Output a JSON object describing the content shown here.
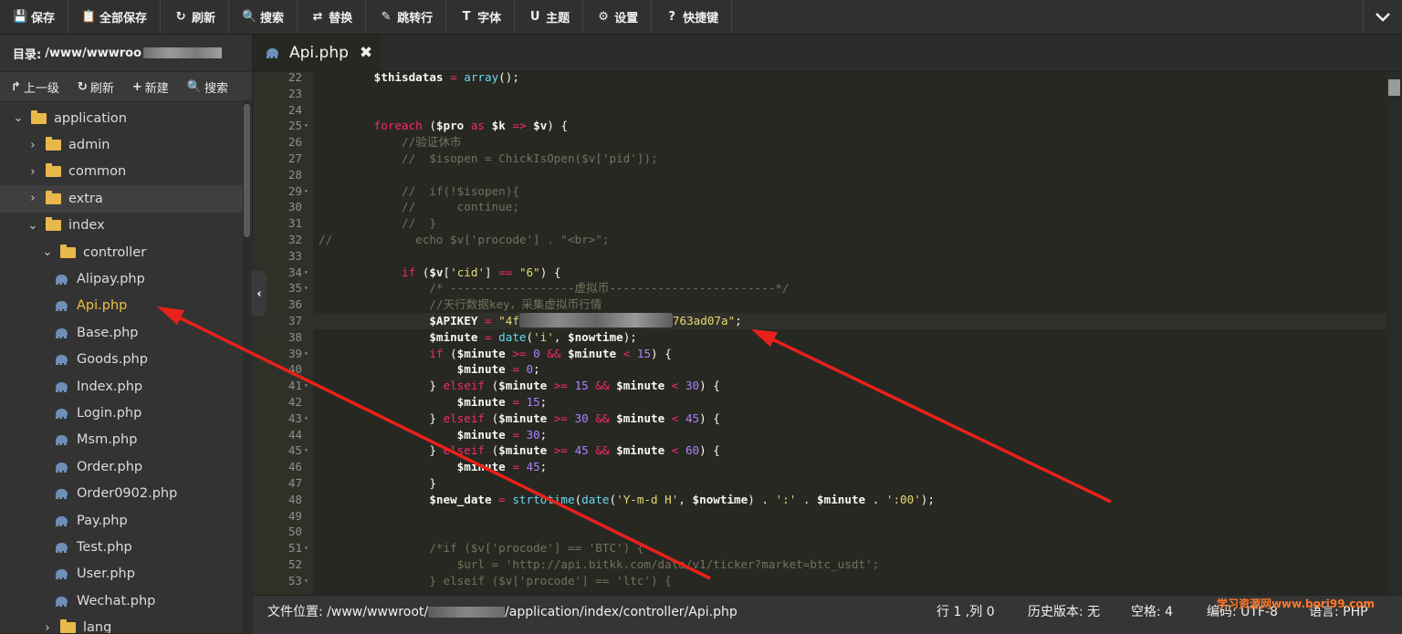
{
  "toolbar": {
    "buttons": [
      {
        "icon": "💾",
        "label": "保存"
      },
      {
        "icon": "📋",
        "label": "全部保存"
      },
      {
        "icon": "↻",
        "label": "刷新"
      },
      {
        "icon": "🔍",
        "label": "搜索"
      },
      {
        "icon": "⇄",
        "label": "替换"
      },
      {
        "icon": "✎",
        "label": "跳转行"
      },
      {
        "icon": "T",
        "label": "字体"
      },
      {
        "icon": "U",
        "label": "主题"
      },
      {
        "icon": "⚙",
        "label": "设置"
      },
      {
        "icon": "?",
        "label": "快捷键"
      }
    ],
    "collapse_icon": "chevron-down-icon"
  },
  "sidebar": {
    "dir_label": "目录:",
    "dir_path": "/www/wwwroo",
    "actions": [
      {
        "icon": "↱",
        "label": "上一级"
      },
      {
        "icon": "↻",
        "label": "刷新"
      },
      {
        "icon": "+",
        "label": "新建"
      },
      {
        "icon": "🔍",
        "label": "搜索"
      }
    ],
    "tree": [
      {
        "name": "application",
        "type": "folder",
        "depth": 0,
        "expanded": true
      },
      {
        "name": "admin",
        "type": "folder",
        "depth": 1,
        "expanded": false
      },
      {
        "name": "common",
        "type": "folder",
        "depth": 1,
        "expanded": false
      },
      {
        "name": "extra",
        "type": "folder",
        "depth": 1,
        "expanded": false,
        "hover": true
      },
      {
        "name": "index",
        "type": "folder",
        "depth": 1,
        "expanded": true
      },
      {
        "name": "controller",
        "type": "folder",
        "depth": 2,
        "expanded": true
      },
      {
        "name": "Alipay.php",
        "type": "file",
        "depth": 3
      },
      {
        "name": "Api.php",
        "type": "file",
        "depth": 3,
        "active": true
      },
      {
        "name": "Base.php",
        "type": "file",
        "depth": 3
      },
      {
        "name": "Goods.php",
        "type": "file",
        "depth": 3
      },
      {
        "name": "Index.php",
        "type": "file",
        "depth": 3
      },
      {
        "name": "Login.php",
        "type": "file",
        "depth": 3
      },
      {
        "name": "Msm.php",
        "type": "file",
        "depth": 3
      },
      {
        "name": "Order.php",
        "type": "file",
        "depth": 3
      },
      {
        "name": "Order0902.php",
        "type": "file",
        "depth": 3
      },
      {
        "name": "Pay.php",
        "type": "file",
        "depth": 3
      },
      {
        "name": "Test.php",
        "type": "file",
        "depth": 3
      },
      {
        "name": "User.php",
        "type": "file",
        "depth": 3
      },
      {
        "name": "Wechat.php",
        "type": "file",
        "depth": 3
      },
      {
        "name": "lang",
        "type": "folder",
        "depth": 2,
        "expanded": false
      }
    ]
  },
  "tab": {
    "label": "Api.php",
    "close": "✖"
  },
  "code_lines": [
    {
      "n": "22",
      "fold": false,
      "tokens": [
        [
          "sp",
          "        "
        ],
        [
          "var",
          "$thisdatas"
        ],
        [
          "op",
          " = "
        ],
        [
          "fn",
          "array"
        ],
        [
          "",
          "();"
        ]
      ]
    },
    {
      "n": "23",
      "fold": false,
      "tokens": []
    },
    {
      "n": "24",
      "fold": false,
      "tokens": []
    },
    {
      "n": "25",
      "fold": true,
      "tokens": [
        [
          "sp",
          "        "
        ],
        [
          "kw",
          "foreach"
        ],
        [
          "",
          " ("
        ],
        [
          "var",
          "$pro"
        ],
        [
          "kw",
          " as "
        ],
        [
          "var",
          "$k"
        ],
        [
          "op",
          " => "
        ],
        [
          "var",
          "$v"
        ],
        [
          "",
          ") {"
        ]
      ]
    },
    {
      "n": "26",
      "fold": false,
      "tokens": [
        [
          "sp",
          "            "
        ],
        [
          "cm",
          "//验证休市"
        ]
      ]
    },
    {
      "n": "27",
      "fold": false,
      "tokens": [
        [
          "sp",
          "            "
        ],
        [
          "cm",
          "//  $isopen = ChickIsOpen($v['pid']);"
        ]
      ]
    },
    {
      "n": "28",
      "fold": false,
      "tokens": []
    },
    {
      "n": "29",
      "fold": true,
      "tokens": [
        [
          "sp",
          "            "
        ],
        [
          "cm",
          "//  if(!$isopen){"
        ]
      ]
    },
    {
      "n": "30",
      "fold": false,
      "tokens": [
        [
          "sp",
          "            "
        ],
        [
          "cm",
          "//      continue;"
        ]
      ]
    },
    {
      "n": "31",
      "fold": false,
      "tokens": [
        [
          "sp",
          "            "
        ],
        [
          "cm",
          "//  }"
        ]
      ]
    },
    {
      "n": "32",
      "fold": false,
      "tokens": [
        [
          "cm",
          "//            echo $v['procode'] . \"<br>\";"
        ]
      ]
    },
    {
      "n": "33",
      "fold": false,
      "tokens": []
    },
    {
      "n": "34",
      "fold": true,
      "tokens": [
        [
          "sp",
          "            "
        ],
        [
          "kw",
          "if"
        ],
        [
          "",
          " ("
        ],
        [
          "var",
          "$v"
        ],
        [
          "",
          "["
        ],
        [
          "str",
          "'cid'"
        ],
        [
          "",
          "]"
        ],
        [
          "op",
          " == "
        ],
        [
          "str",
          "\"6\""
        ],
        [
          "",
          ") {"
        ]
      ]
    },
    {
      "n": "35",
      "fold": true,
      "tokens": [
        [
          "sp",
          "                "
        ],
        [
          "cm",
          "/* ------------------虚拟币------------------------*/"
        ]
      ]
    },
    {
      "n": "36",
      "fold": false,
      "tokens": [
        [
          "sp",
          "                "
        ],
        [
          "cm",
          "//天行数据key，采集虚拟币行情"
        ]
      ]
    },
    {
      "n": "37",
      "fold": false,
      "cur": true,
      "tokens": [
        [
          "sp",
          "                "
        ],
        [
          "var",
          "$APIKEY"
        ],
        [
          "op",
          " = "
        ],
        [
          "str",
          "\"4f"
        ],
        [
          "blur",
          ""
        ],
        [
          "str",
          "763ad07a\""
        ],
        [
          "",
          ";"
        ]
      ]
    },
    {
      "n": "38",
      "fold": false,
      "tokens": [
        [
          "sp",
          "                "
        ],
        [
          "var",
          "$minute"
        ],
        [
          "op",
          " = "
        ],
        [
          "fn",
          "date"
        ],
        [
          "",
          "("
        ],
        [
          "str",
          "'i'"
        ],
        [
          "",
          ", "
        ],
        [
          "var",
          "$nowtime"
        ],
        [
          "",
          ");"
        ]
      ]
    },
    {
      "n": "39",
      "fold": true,
      "tokens": [
        [
          "sp",
          "                "
        ],
        [
          "kw",
          "if"
        ],
        [
          "",
          " ("
        ],
        [
          "var",
          "$minute"
        ],
        [
          "op",
          " >= "
        ],
        [
          "num",
          "0"
        ],
        [
          "op",
          " && "
        ],
        [
          "var",
          "$minute"
        ],
        [
          "op",
          " < "
        ],
        [
          "num",
          "15"
        ],
        [
          "",
          ") {"
        ]
      ]
    },
    {
      "n": "40",
      "fold": false,
      "tokens": [
        [
          "sp",
          "                    "
        ],
        [
          "var",
          "$minute"
        ],
        [
          "op",
          " = "
        ],
        [
          "num",
          "0"
        ],
        [
          "",
          ";"
        ]
      ]
    },
    {
      "n": "41",
      "fold": true,
      "tokens": [
        [
          "sp",
          "                "
        ],
        [
          "",
          "} "
        ],
        [
          "kw",
          "elseif"
        ],
        [
          "",
          " ("
        ],
        [
          "var",
          "$minute"
        ],
        [
          "op",
          " >= "
        ],
        [
          "num",
          "15"
        ],
        [
          "op",
          " && "
        ],
        [
          "var",
          "$minute"
        ],
        [
          "op",
          " < "
        ],
        [
          "num",
          "30"
        ],
        [
          "",
          ") {"
        ]
      ]
    },
    {
      "n": "42",
      "fold": false,
      "tokens": [
        [
          "sp",
          "                    "
        ],
        [
          "var",
          "$minute"
        ],
        [
          "op",
          " = "
        ],
        [
          "num",
          "15"
        ],
        [
          "",
          ";"
        ]
      ]
    },
    {
      "n": "43",
      "fold": true,
      "tokens": [
        [
          "sp",
          "                "
        ],
        [
          "",
          "} "
        ],
        [
          "kw",
          "elseif"
        ],
        [
          "",
          " ("
        ],
        [
          "var",
          "$minute"
        ],
        [
          "op",
          " >= "
        ],
        [
          "num",
          "30"
        ],
        [
          "op",
          " && "
        ],
        [
          "var",
          "$minute"
        ],
        [
          "op",
          " < "
        ],
        [
          "num",
          "45"
        ],
        [
          "",
          ") {"
        ]
      ]
    },
    {
      "n": "44",
      "fold": false,
      "tokens": [
        [
          "sp",
          "                    "
        ],
        [
          "var",
          "$minute"
        ],
        [
          "op",
          " = "
        ],
        [
          "num",
          "30"
        ],
        [
          "",
          ";"
        ]
      ]
    },
    {
      "n": "45",
      "fold": true,
      "tokens": [
        [
          "sp",
          "                "
        ],
        [
          "",
          "} "
        ],
        [
          "kw",
          "elseif"
        ],
        [
          "",
          " ("
        ],
        [
          "var",
          "$minute"
        ],
        [
          "op",
          " >= "
        ],
        [
          "num",
          "45"
        ],
        [
          "op",
          " && "
        ],
        [
          "var",
          "$minute"
        ],
        [
          "op",
          " < "
        ],
        [
          "num",
          "60"
        ],
        [
          "",
          ") {"
        ]
      ]
    },
    {
      "n": "46",
      "fold": false,
      "tokens": [
        [
          "sp",
          "                    "
        ],
        [
          "var",
          "$minute"
        ],
        [
          "op",
          " = "
        ],
        [
          "num",
          "45"
        ],
        [
          "",
          ";"
        ]
      ]
    },
    {
      "n": "47",
      "fold": false,
      "tokens": [
        [
          "sp",
          "                "
        ],
        [
          "",
          "}"
        ]
      ]
    },
    {
      "n": "48",
      "fold": false,
      "tokens": [
        [
          "sp",
          "                "
        ],
        [
          "var",
          "$new_date"
        ],
        [
          "op",
          " = "
        ],
        [
          "fn",
          "strtotime"
        ],
        [
          "",
          "("
        ],
        [
          "fn",
          "date"
        ],
        [
          "",
          "("
        ],
        [
          "str",
          "'Y-m-d H'"
        ],
        [
          "",
          ", "
        ],
        [
          "var",
          "$nowtime"
        ],
        [
          "",
          ") . "
        ],
        [
          "str",
          "':'"
        ],
        [
          "",
          " . "
        ],
        [
          "var",
          "$minute"
        ],
        [
          "",
          " . "
        ],
        [
          "str",
          "':00'"
        ],
        [
          "",
          ");"
        ]
      ]
    },
    {
      "n": "49",
      "fold": false,
      "tokens": []
    },
    {
      "n": "50",
      "fold": false,
      "tokens": []
    },
    {
      "n": "51",
      "fold": true,
      "tokens": [
        [
          "sp",
          "                "
        ],
        [
          "cm",
          "/*if ($v['procode'] == 'BTC') {"
        ]
      ]
    },
    {
      "n": "52",
      "fold": false,
      "tokens": [
        [
          "sp",
          "                    "
        ],
        [
          "cm",
          "$url = 'http://api.bitkk.com/data/v1/ticker?market=btc_usdt';"
        ]
      ]
    },
    {
      "n": "53",
      "fold": true,
      "tokens": [
        [
          "sp",
          "                "
        ],
        [
          "cm",
          "} elseif ($v['procode'] == 'ltc') {"
        ]
      ]
    }
  ],
  "statusbar": {
    "path_label": "文件位置:",
    "path_prefix": "/www/wwwroot/",
    "path_suffix": "/application/index/controller/Api.php",
    "position": "行 1 ,列 0",
    "history": "历史版本: 无",
    "spaces": "空格: 4",
    "encoding": "编码: UTF-8",
    "language": "语言: PHP",
    "watermark": "学习资源网www.bori99.com"
  }
}
